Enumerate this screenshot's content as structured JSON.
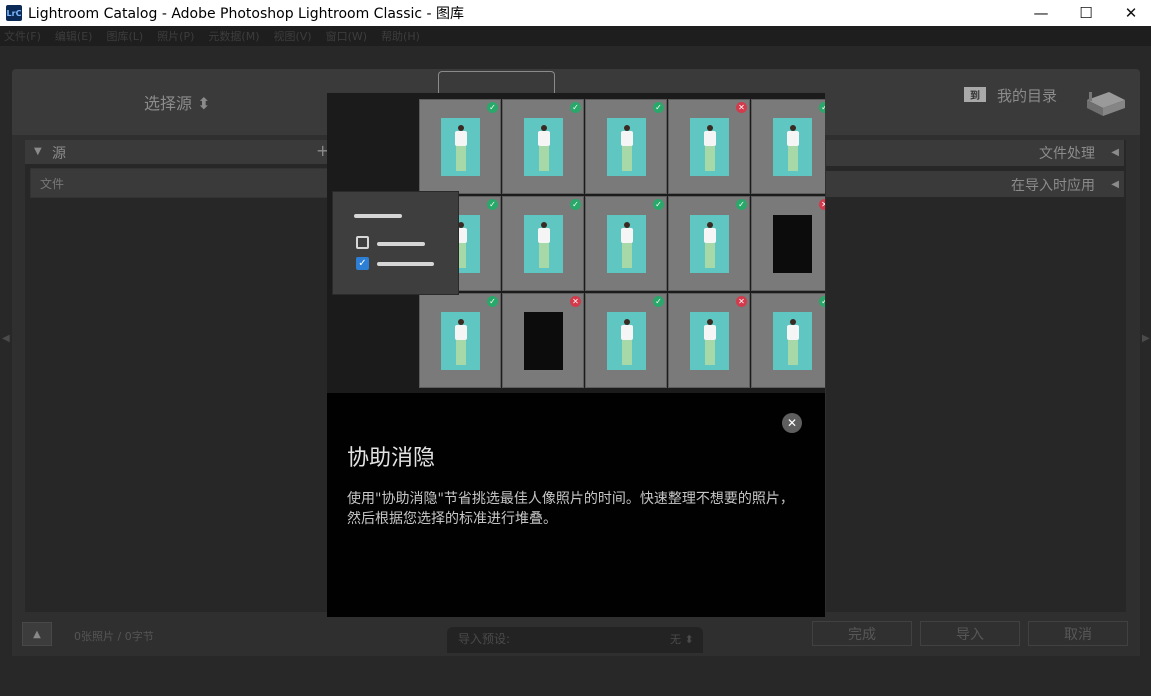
{
  "window": {
    "title": "Lightroom Catalog - Adobe Photoshop Lightroom Classic - 图库",
    "app_icon_text": "LrC",
    "minimize": "—",
    "maximize": "☐",
    "close": "✕"
  },
  "menu": [
    "文件(F)",
    "编辑(E)",
    "图库(L)",
    "照片(P)",
    "元数据(M)",
    "视图(V)",
    "窗口(W)",
    "帮助(H)"
  ],
  "import": {
    "select_source": "选择源 ⬍",
    "my_catalog": "我的目录",
    "dest_icon_text": "到",
    "source_panel": {
      "title": "源",
      "plus": "+",
      "files_label": "文件"
    },
    "right_panels": [
      {
        "label": "文件处理"
      },
      {
        "label": "在导入时应用"
      }
    ],
    "status": "0张照片 / 0字节",
    "preview_label": "导入预设:",
    "preview_value": "无 ⬍",
    "buttons": {
      "done": "完成",
      "import": "导入",
      "cancel": "取消"
    }
  },
  "dialog": {
    "title": "协助消隐",
    "body": "使用\"协助消隐\"节省挑选最佳人像照片的时间。快速整理不想要的照片，然后根据您选择的标准进行堆叠。",
    "close_icon": "✕",
    "grid": [
      {
        "status": "accepted",
        "dark": false
      },
      {
        "status": "accepted",
        "dark": false
      },
      {
        "status": "accepted",
        "dark": false
      },
      {
        "status": "rejected",
        "dark": false
      },
      {
        "status": "accepted",
        "dark": false
      },
      {
        "status": "accepted",
        "dark": false
      },
      {
        "status": "accepted",
        "dark": false
      },
      {
        "status": "accepted",
        "dark": false
      },
      {
        "status": "accepted",
        "dark": false
      },
      {
        "status": "rejected",
        "dark": true
      },
      {
        "status": "accepted",
        "dark": false
      },
      {
        "status": "rejected",
        "dark": true
      },
      {
        "status": "accepted",
        "dark": false
      },
      {
        "status": "rejected",
        "dark": false
      },
      {
        "status": "accepted",
        "dark": false
      }
    ],
    "accepted_icon": "✓",
    "rejected_icon": "✕",
    "check_icon": "✓"
  },
  "colors": {
    "accepted": "#29a86a",
    "rejected": "#d33a4c",
    "photo_bg": "#5fc6c2",
    "checkbox": "#2d7fd6"
  }
}
